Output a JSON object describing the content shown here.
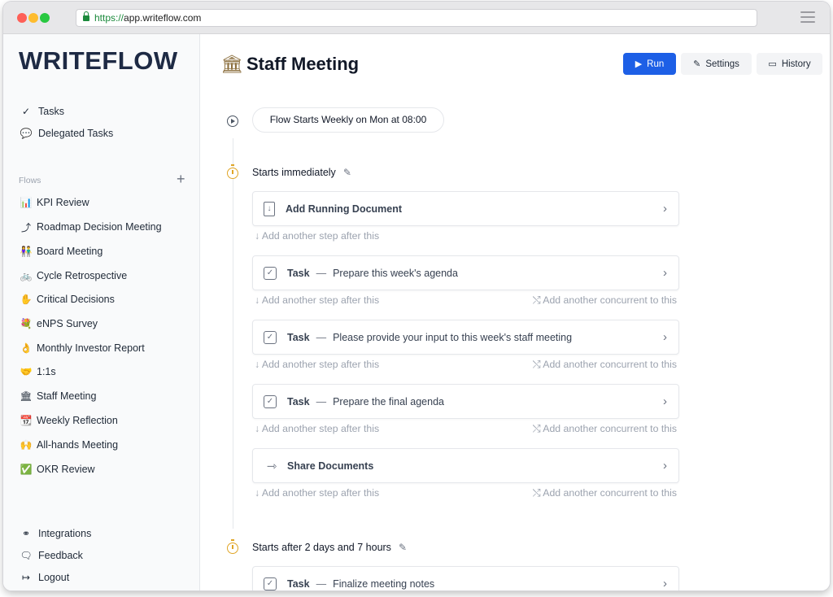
{
  "browser": {
    "url_scheme": "https://",
    "url_host": "app.writeflow.com"
  },
  "sidebar": {
    "logo": "WRITEFLOW",
    "top_items": [
      {
        "icon": "✓",
        "label": "Tasks"
      },
      {
        "icon": "💬",
        "label": "Delegated Tasks"
      }
    ],
    "flows_title": "Flows",
    "flows_add": "+",
    "flows": [
      {
        "emoji": "📊",
        "label": "KPI Review"
      },
      {
        "emoji": "⤴",
        "label": "Roadmap Decision Meeting"
      },
      {
        "emoji": "👫",
        "label": "Board Meeting"
      },
      {
        "emoji": "🚲",
        "label": "Cycle Retrospective"
      },
      {
        "emoji": "✋",
        "label": "Critical Decisions"
      },
      {
        "emoji": "💐",
        "label": "eNPS Survey"
      },
      {
        "emoji": "👌",
        "label": "Monthly Investor Report"
      },
      {
        "emoji": "🤝",
        "label": "1:1s"
      },
      {
        "emoji": "🏛",
        "label": "Staff Meeting"
      },
      {
        "emoji": "📆",
        "label": "Weekly Reflection"
      },
      {
        "emoji": "🙌",
        "label": "All-hands Meeting"
      },
      {
        "emoji": "✅",
        "label": "OKR Review"
      }
    ],
    "bottom_items": [
      {
        "icon": "⚭",
        "label": "Integrations"
      },
      {
        "icon": "🗨",
        "label": "Feedback"
      },
      {
        "icon": "↦",
        "label": "Logout"
      }
    ]
  },
  "main": {
    "title_icon": "🏛",
    "title": "Staff Meeting",
    "buttons": {
      "run": {
        "icon": "▶",
        "label": "Run"
      },
      "settings": {
        "icon": "✎",
        "label": "Settings"
      },
      "history": {
        "icon": "▭",
        "label": "History"
      }
    },
    "start_pill": "Flow Starts Weekly on Mon at 08:00",
    "stages": [
      {
        "label": "Starts immediately",
        "steps": [
          {
            "kind": "doc",
            "title": "Add Running Document",
            "desc": ""
          },
          {
            "kind": "task",
            "title": "Task",
            "desc": "Prepare this week's agenda"
          },
          {
            "kind": "task",
            "title": "Task",
            "desc": "Please provide your input to this week's staff meeting"
          },
          {
            "kind": "task",
            "title": "Task",
            "desc": "Prepare the final agenda"
          },
          {
            "kind": "share",
            "title": "Share Documents",
            "desc": ""
          }
        ]
      },
      {
        "label": "Starts after 2 days and 7 hours",
        "steps": [
          {
            "kind": "task",
            "title": "Task",
            "desc": "Finalize meeting notes"
          }
        ]
      }
    ],
    "add_after_label": "↓ Add another step after this",
    "add_concurrent_label": "⤭ Add another concurrent to this",
    "dash": "—",
    "chevron": "›"
  }
}
